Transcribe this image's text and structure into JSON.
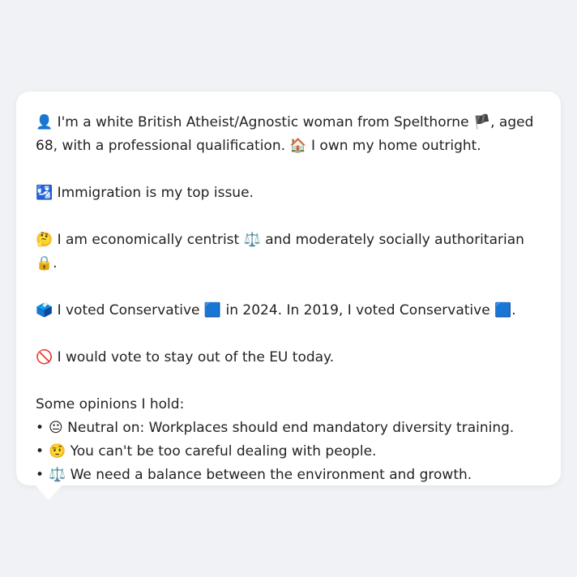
{
  "bio": {
    "person_icon": "👤",
    "line1_text_a": "I'm a white British Atheist/Agnostic woman from Spelthorne",
    "flag_icon": "🏴",
    "line1_text_b": ", aged 68, with a professional qualification.",
    "home_icon": "🏠",
    "line1_text_c": "I own my home outright."
  },
  "issue": {
    "icon": "🛂",
    "text": "Immigration is my top issue."
  },
  "politics": {
    "thinking_icon": "🤔",
    "text_a": "I am economically centrist",
    "scale_icon": "⚖️",
    "text_b": "and moderately socially authoritarian",
    "lock_icon": "🔒",
    "text_c": "."
  },
  "vote": {
    "ballot_icon": "🗳️",
    "text_a": "I voted Conservative",
    "party_icon_1": "🟦",
    "text_b": "in 2024. In 2019, I voted Conservative",
    "party_icon_2": "🟦",
    "text_c": "."
  },
  "eu": {
    "icon": "🚫",
    "text": "I would vote to stay out of the EU today."
  },
  "opinions": {
    "heading": "Some opinions I hold:",
    "bullet": "•",
    "items": [
      {
        "icon": "😐",
        "text": "Neutral on: Workplaces should end mandatory diversity training."
      },
      {
        "icon": "🤨",
        "text": "You can't be too careful dealing with people."
      },
      {
        "icon": "⚖️",
        "text": "We need a balance between the environment and growth."
      }
    ]
  }
}
